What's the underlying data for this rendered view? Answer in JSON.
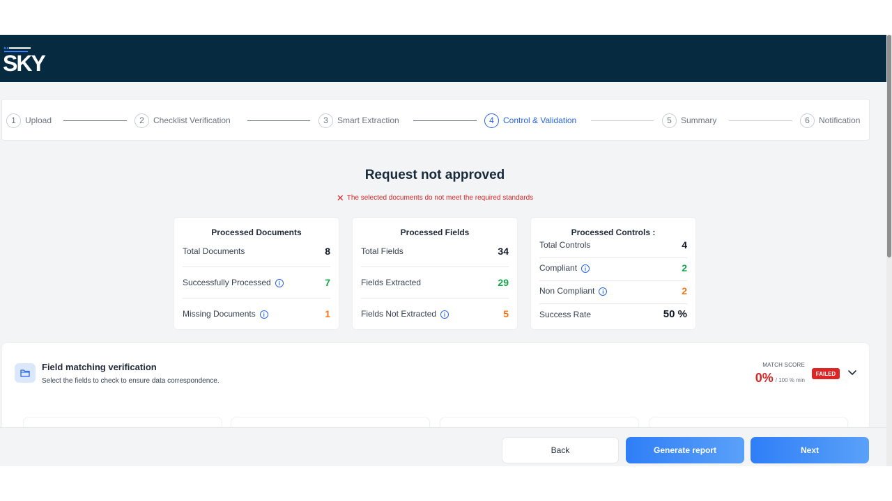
{
  "brand": {
    "logo_text": "SKY",
    "bar_color": "#062b40"
  },
  "stepper": {
    "steps": [
      {
        "num": "1",
        "label": "Upload",
        "state": "done"
      },
      {
        "num": "2",
        "label": "Checklist Verification",
        "state": "done"
      },
      {
        "num": "3",
        "label": "Smart Extraction",
        "state": "done"
      },
      {
        "num": "4",
        "label": "Control & Validation",
        "state": "active"
      },
      {
        "num": "5",
        "label": "Summary",
        "state": "pending"
      },
      {
        "num": "6",
        "label": "Notification",
        "state": "pending"
      }
    ],
    "active_color": "#2563eb"
  },
  "status": {
    "title": "Request not approved",
    "message": "The selected documents do not meet the required standards",
    "icon": "close-x-icon",
    "error_color": "#dc2626"
  },
  "cards": {
    "documents": {
      "title": "Processed Documents",
      "rows": [
        {
          "label": "Total Documents",
          "value": "8"
        },
        {
          "label": "Successfully Processed",
          "value": "7"
        },
        {
          "label": "Missing Documents",
          "value": "1"
        }
      ]
    },
    "fields": {
      "title": "Processed Fields",
      "rows": [
        {
          "label": "Total Fields",
          "value": "34"
        },
        {
          "label": "Fields Extracted",
          "value": "29"
        },
        {
          "label": "Fields Not Extracted",
          "value": "5"
        }
      ]
    },
    "controls": {
      "title": "Processed Controls :",
      "rows": [
        {
          "label": "Total Controls",
          "value": "4"
        },
        {
          "label": "Compliant",
          "value": "2"
        },
        {
          "label": "Non Compliant",
          "value": "2"
        },
        {
          "label": "Success Rate",
          "value": "50 %"
        }
      ]
    },
    "colors": {
      "green": "#16a34a",
      "orange": "#f97316"
    }
  },
  "field_matching": {
    "title": "Field matching verification",
    "subtitle": "Select the fields to check to ensure data correspondence.",
    "match_score_label": "MATCH SCORE",
    "score": "0%",
    "score_min": "/ 100 % min",
    "badge": "FAILED",
    "icon": "folder-icon"
  },
  "footer": {
    "back_label": "Back",
    "generate_label": "Generate report",
    "next_label": "Next"
  }
}
